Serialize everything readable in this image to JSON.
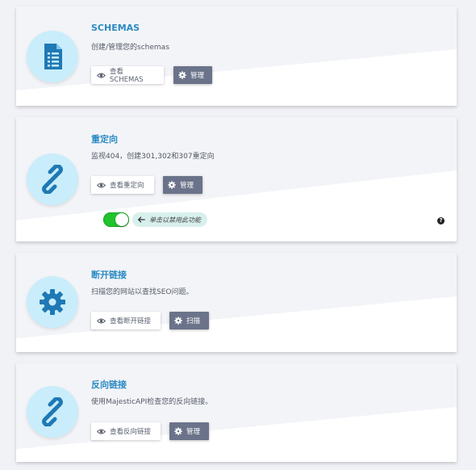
{
  "cards": [
    {
      "title": "SCHEMAS",
      "desc": "创建/管理您的schemas",
      "view_label": "查看SCHEMAS",
      "action_label": "管理",
      "icon": "document-list-icon",
      "action_icon": "gear-icon"
    },
    {
      "title": "重定向",
      "desc": "监视404，创建301,302和307重定向",
      "view_label": "查看重定向",
      "action_label": "管理",
      "icon": "link-icon",
      "action_icon": "gear-icon",
      "toggle_on": true,
      "toggle_hint": "单击以禁用此功能",
      "help_label": "?"
    },
    {
      "title": "断开链接",
      "desc": "扫描您的网站以查找SEO问题。",
      "view_label": "查看断开链接",
      "action_label": "扫描",
      "icon": "gear-icon",
      "action_icon": "gear-icon"
    },
    {
      "title": "反向链接",
      "desc": "使用MajesticAPI检查您的反向链接。",
      "view_label": "查看反向链接",
      "action_label": "管理",
      "icon": "link-icon",
      "action_icon": "gear-icon"
    }
  ],
  "colors": {
    "title": "#2a8ac3",
    "icon": "#1f79b5",
    "icon_circle": "#c9edfb",
    "manage_button": "#6a7389",
    "toggle_on": "#21c32e"
  }
}
